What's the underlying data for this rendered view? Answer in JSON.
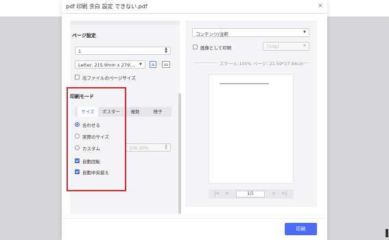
{
  "window": {
    "title": "pdf 印刷 余白 設定 できない.pdf",
    "close_glyph": "×"
  },
  "page_settings": {
    "title": "ページ設定",
    "copies_value": "1",
    "paper_size": "Letter: 215.9mm x 279....",
    "original_page_size_label": "元ファイルのページサイズ"
  },
  "print_mode": {
    "title": "印刷モード",
    "tabs": [
      "サイズ",
      "ポスター",
      "複数",
      "冊子"
    ],
    "active_tab": "サイズ",
    "options": [
      {
        "label": "合わせる",
        "selected": true
      },
      {
        "label": "実際のサイズ",
        "selected": false
      },
      {
        "label": "カスタム",
        "selected": false
      }
    ],
    "custom_scale": "100.00%",
    "auto_rotate": "自動回転",
    "auto_center": "自動中央揃え"
  },
  "right": {
    "content_select": "コンテンツ/注釈",
    "print_as_image": "画像として印刷",
    "dpi": "72dpi",
    "scale_info": "スケール:100%  ページ: 21.59*27.94cm",
    "page_indicator": "1/1"
  },
  "footer": {
    "print_label": "印刷"
  },
  "colors": {
    "accent": "#4a6cf7",
    "highlight_box": "#d9262f"
  },
  "icons": [
    "close-icon",
    "chevron-down-icon",
    "spinner-icon",
    "portrait-icon",
    "landscape-icon",
    "first-page-icon",
    "prev-page-icon",
    "next-page-icon",
    "last-page-icon"
  ]
}
